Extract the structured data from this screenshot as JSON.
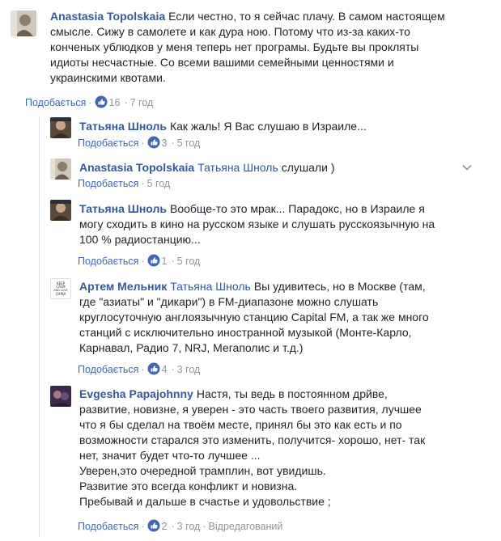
{
  "like_label": "Подобається",
  "comments": [
    {
      "author": "Anastasia Topolskaia",
      "lines": [
        "Если честно, то я сейчас плачу. В самом настоящем",
        "смысле. Сижу в самолете и как дура ною. Потому что из-за каких-то",
        "конченых ублюдков у меня теперь нет програмы. Будьте вы прокляты",
        "идиоты несчастные. Со всеми вашими семейными ценностями и",
        "украинскими квотами."
      ],
      "reactions": "16",
      "time": "7 год"
    },
    {
      "author": "Татьяна Шноль",
      "lines": [
        "Как жаль! Я Вас слушаю в Израиле..."
      ],
      "reactions": "3",
      "time": "5 год"
    },
    {
      "author": "Anastasia Topolskaia",
      "mention": "Татьяна Шноль",
      "lines": [
        "слушали )"
      ],
      "time": "5 год"
    },
    {
      "author": "Татьяна Шноль",
      "lines": [
        "Вообще-то это мрак... Парадокс, но в Израиле я",
        "могу сходить в кино на русском языке и слушать русскоязычную на",
        "100 % радиостанцию..."
      ],
      "reactions": "1",
      "time": "5 год"
    },
    {
      "author": "Артем Мельник",
      "mention": "Татьяна Шноль",
      "avatar_text": "KEEP CALM AND LOVE CHINA",
      "lines": [
        "Вы удивитесь, но в Москве (там,",
        "где \"азиаты\" и \"дикари\") в FM-диапазоне можно слушать",
        "круглосуточную англоязычную станцию Capital FM, а так же много",
        "станций с исключительно иностранной музыкой (Монте-Карло,",
        "Карнавал, Радио 7, NRJ, Мегаполис и т.д.)"
      ],
      "reactions": "4",
      "time": "3 год"
    },
    {
      "author": "Evgesha Papajohnny",
      "lines": [
        "Настя, ты ведь в постоянном дрйве,",
        "развитие, новизне, я уверен - это часть твоего развития, лучшее",
        "что я бы сделал на твоём месте, принял бы это как есть и по",
        "возможности старался это изменить, получится- хорошо, нет- так",
        "нет, значит будет что-то лучшее ...",
        "Уверен,это очередной трамплин, вот увидишь.",
        "Развитие это всегда конфликт и новизна.",
        "Пребывай и дальше в счастье и удовольствие ;"
      ],
      "reactions": "2",
      "time": "3 год",
      "edited": "Відредагований"
    }
  ],
  "colors": {
    "link": "#365899",
    "meta": "#90949c",
    "like_bubble": "#4267b2"
  }
}
